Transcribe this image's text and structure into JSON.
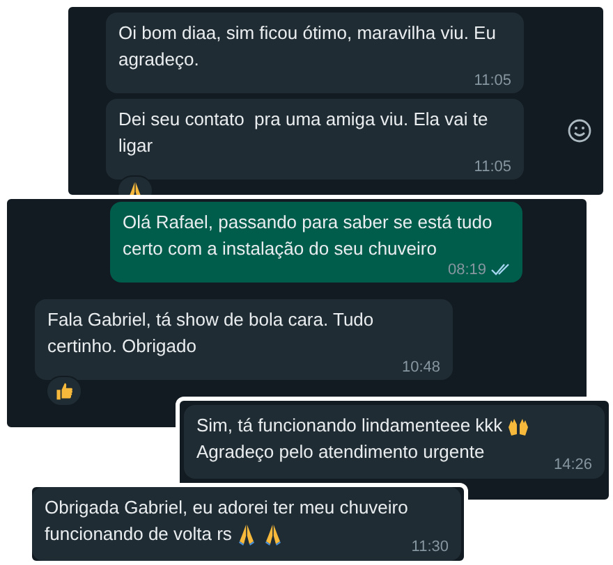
{
  "screenshots": [
    {
      "messages": [
        {
          "kind": "incoming",
          "text": "Oi bom diaa, sim ficou ótimo, maravilha viu. Eu agradeço.",
          "time": "11:05"
        },
        {
          "kind": "incoming",
          "text": "Dei seu contato  pra uma amiga viu. Ela vai te ligar",
          "time": "11:05",
          "reaction": {
            "kind": "pray"
          }
        }
      ]
    },
    {
      "messages": [
        {
          "kind": "outgoing",
          "text": "Olá Rafael, passando para saber se está tudo certo com a instalação do seu chuveiro",
          "time": "08:19",
          "read": true
        },
        {
          "kind": "incoming",
          "text": "Fala Gabriel, tá show de bola cara. Tudo certinho. Obrigado",
          "time": "10:48",
          "reaction": {
            "kind": "thumbs"
          }
        }
      ]
    },
    {
      "messages": [
        {
          "kind": "incoming",
          "text": "Sim, tá funcionando lindamenteee kkk",
          "emojis": [
            {
              "kind": "raised_hands"
            }
          ],
          "text_2": "Agradeço pelo atendimento urgente",
          "time": "14:26"
        }
      ]
    },
    {
      "messages": [
        {
          "kind": "incoming",
          "text": "Obrigada Gabriel, eu adorei ter meu chuveiro",
          "text_2": "funcionando de volta rs",
          "emojis_2": [
            {
              "kind": "pray"
            },
            {
              "kind": "pray"
            }
          ],
          "time": "11:30"
        }
      ]
    }
  ]
}
